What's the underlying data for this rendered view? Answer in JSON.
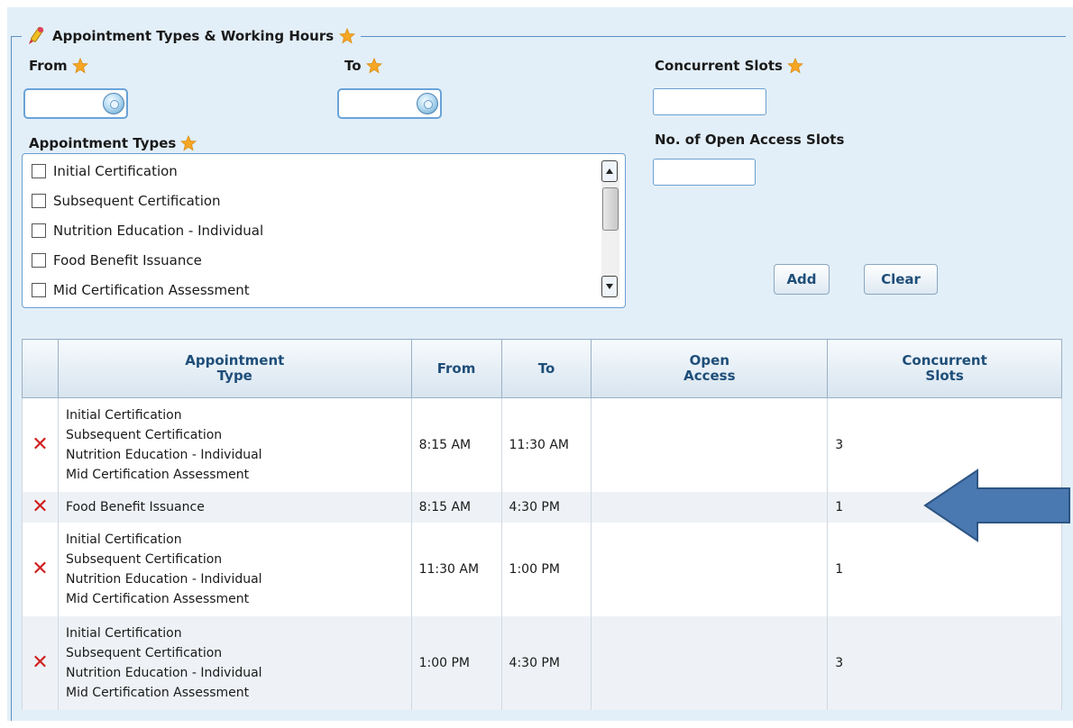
{
  "fieldset": {
    "legend": "Appointment Types & Working Hours"
  },
  "form": {
    "from_label": "From",
    "to_label": "To",
    "concurrent_slots_label": "Concurrent Slots",
    "open_access_label": "No. of Open Access Slots",
    "appointment_types_label": "Appointment Types",
    "from_value": "",
    "to_value": "",
    "concurrent_slots_value": "",
    "open_access_value": "",
    "appointment_types": [
      {
        "label": "Initial Certification",
        "checked": false
      },
      {
        "label": "Subsequent Certification",
        "checked": false
      },
      {
        "label": "Nutrition Education - Individual",
        "checked": false
      },
      {
        "label": "Food Benefit Issuance",
        "checked": false
      },
      {
        "label": "Mid Certification Assessment",
        "checked": false
      }
    ],
    "add_label": "Add",
    "clear_label": "Clear"
  },
  "table": {
    "headers": {
      "type_line1": "Appointment",
      "type_line2": "Type",
      "from": "From",
      "to": "To",
      "open_line1": "Open",
      "open_line2": "Access",
      "slots_line1": "Concurrent",
      "slots_line2": "Slots"
    },
    "rows": [
      {
        "types": [
          "Initial Certification",
          "Subsequent Certification",
          "Nutrition Education - Individual",
          "Mid Certification Assessment"
        ],
        "from": "8:15 AM",
        "to": "11:30 AM",
        "open_access": "",
        "slots": "3"
      },
      {
        "types": [
          "Food Benefit Issuance"
        ],
        "from": "8:15 AM",
        "to": "4:30 PM",
        "open_access": "",
        "slots": "1"
      },
      {
        "types": [
          "Initial Certification",
          "Subsequent Certification",
          "Nutrition Education - Individual",
          "Mid Certification Assessment"
        ],
        "from": "11:30 AM",
        "to": "1:00 PM",
        "open_access": "",
        "slots": "1"
      },
      {
        "types": [
          "Initial Certification",
          "Subsequent Certification",
          "Nutrition Education - Individual",
          "Mid Certification Assessment"
        ],
        "from": "1:00 PM",
        "to": "4:30 PM",
        "open_access": "",
        "slots": "3"
      }
    ],
    "delete_glyph": "✕"
  },
  "colors": {
    "accent": "#1f4e79",
    "panel": "#e3eff8",
    "star": "#f5a623",
    "delete": "#d02020",
    "arrow": "#4a78b0"
  }
}
